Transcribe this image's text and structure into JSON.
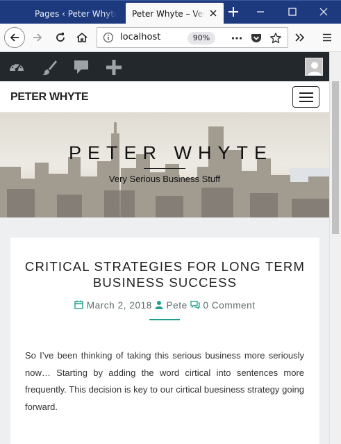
{
  "browser": {
    "tabs": [
      {
        "title": "Pages ‹ Peter Whyte — WordPress",
        "active": false
      },
      {
        "title": "Peter Whyte – Very Serious Business Stuff",
        "active": true
      }
    ],
    "url": "localhost",
    "zoom": "90%"
  },
  "site": {
    "name": "PETER WHYTE",
    "hero_title": "PETER WHYTE",
    "tagline": "Very Serious Business Stuff"
  },
  "post": {
    "title": "CRITICAL STRATEGIES FOR LONG TERM BUSINESS SUCCESS",
    "date": "March 2, 2018",
    "author": "Pete",
    "comments": "0 Comment",
    "body": "So I’ve been thinking of taking this serious business more seriously now… Starting by adding the word cirtical into sentences more frequently. This decision is key to our cirtical buesiness strategy going forward."
  },
  "colors": {
    "titlebar": "#1e3a7e",
    "admin_bar": "#23282d",
    "accent": "#1e9e8c",
    "page_bg": "#eeeff1"
  },
  "icons": {
    "admin_bar": [
      "dashboard-icon",
      "customize-brush-icon",
      "comments-icon",
      "new-content-plus-icon"
    ],
    "toolbar": [
      "back-icon",
      "forward-icon",
      "reload-icon",
      "home-icon",
      "page-actions-icon",
      "pocket-icon",
      "bookmark-star-icon",
      "overflow-icon",
      "hamburger-menu-icon"
    ]
  }
}
